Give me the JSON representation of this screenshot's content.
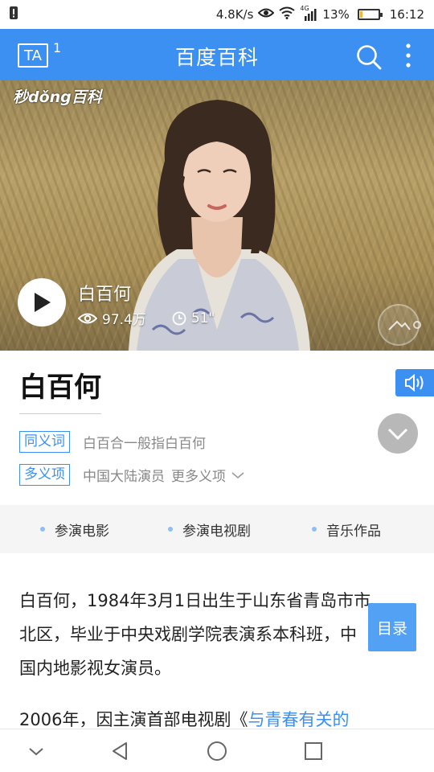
{
  "status_bar": {
    "speed": "4.8K/s",
    "network_type": "4G",
    "battery": "13%",
    "battery_level": 0.13,
    "time": "16:12"
  },
  "header": {
    "ta_label": "TA",
    "ta_badge": "1",
    "title": "百度百科"
  },
  "video": {
    "watermark": "秒dǒng百科",
    "name": "白百何",
    "views": "97.4万",
    "duration": "51\""
  },
  "entry": {
    "title": "白百何"
  },
  "synonym": {
    "tag": "同义词",
    "text": "白百合一般指白百何"
  },
  "polysemy": {
    "tag": "多义项",
    "text": "中国大陆演员",
    "more": "更多义项"
  },
  "tabs": [
    "参演电影",
    "参演电视剧",
    "音乐作品"
  ],
  "content": {
    "p1_line1": "白百何，1984年3月1日出生于山东省青岛市市",
    "p1_line2": "北区，毕业于中央戏剧学院表演系本科班，中",
    "p1_line3": "国内地影视女演员。",
    "p2_prefix": "2006年，因主演首部电视剧《",
    "p2_link": "与青春有关的"
  },
  "toc_button": "目录",
  "colors": {
    "brand_blue": "#3b90f2",
    "toc_blue": "#52a1f5",
    "tab_dot": "#8fbdf5"
  }
}
